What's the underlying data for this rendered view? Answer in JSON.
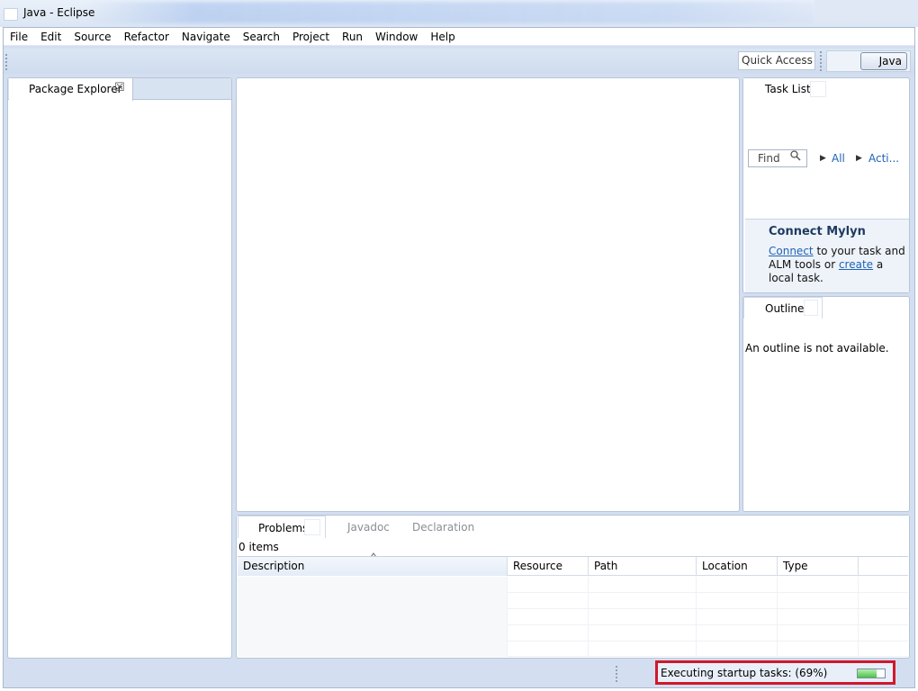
{
  "window": {
    "title": "Java - Eclipse"
  },
  "menu": [
    "File",
    "Edit",
    "Source",
    "Refactor",
    "Navigate",
    "Search",
    "Project",
    "Run",
    "Window",
    "Help"
  ],
  "toolbar": {
    "quick_access": "Quick Access",
    "perspective": "Java"
  },
  "package_explorer": {
    "tab_label": "Package Explorer"
  },
  "task_list": {
    "tab_label": "Task List",
    "find_placeholder": "Find",
    "filter_all": "All",
    "filter_active": "Acti..."
  },
  "mylyn": {
    "title": "Connect Mylyn",
    "connect_link": "Connect",
    "text1": " to your task and ALM tools or ",
    "create_link": "create",
    "text2": " a local task."
  },
  "outline": {
    "tab_label": "Outline",
    "message": "An outline is not available."
  },
  "problems": {
    "tabs": [
      "Problems",
      "Javadoc",
      "Declaration"
    ],
    "item_count": "0 items",
    "columns": [
      "Description",
      "Resource",
      "Path",
      "Location",
      "Type"
    ]
  },
  "status": {
    "message": "Executing startup tasks: (69%)",
    "progress": 0.69
  },
  "colors": {
    "highlight_box": "#d0182b",
    "link": "#1e63b5",
    "progress_green": "#4cc04a"
  }
}
